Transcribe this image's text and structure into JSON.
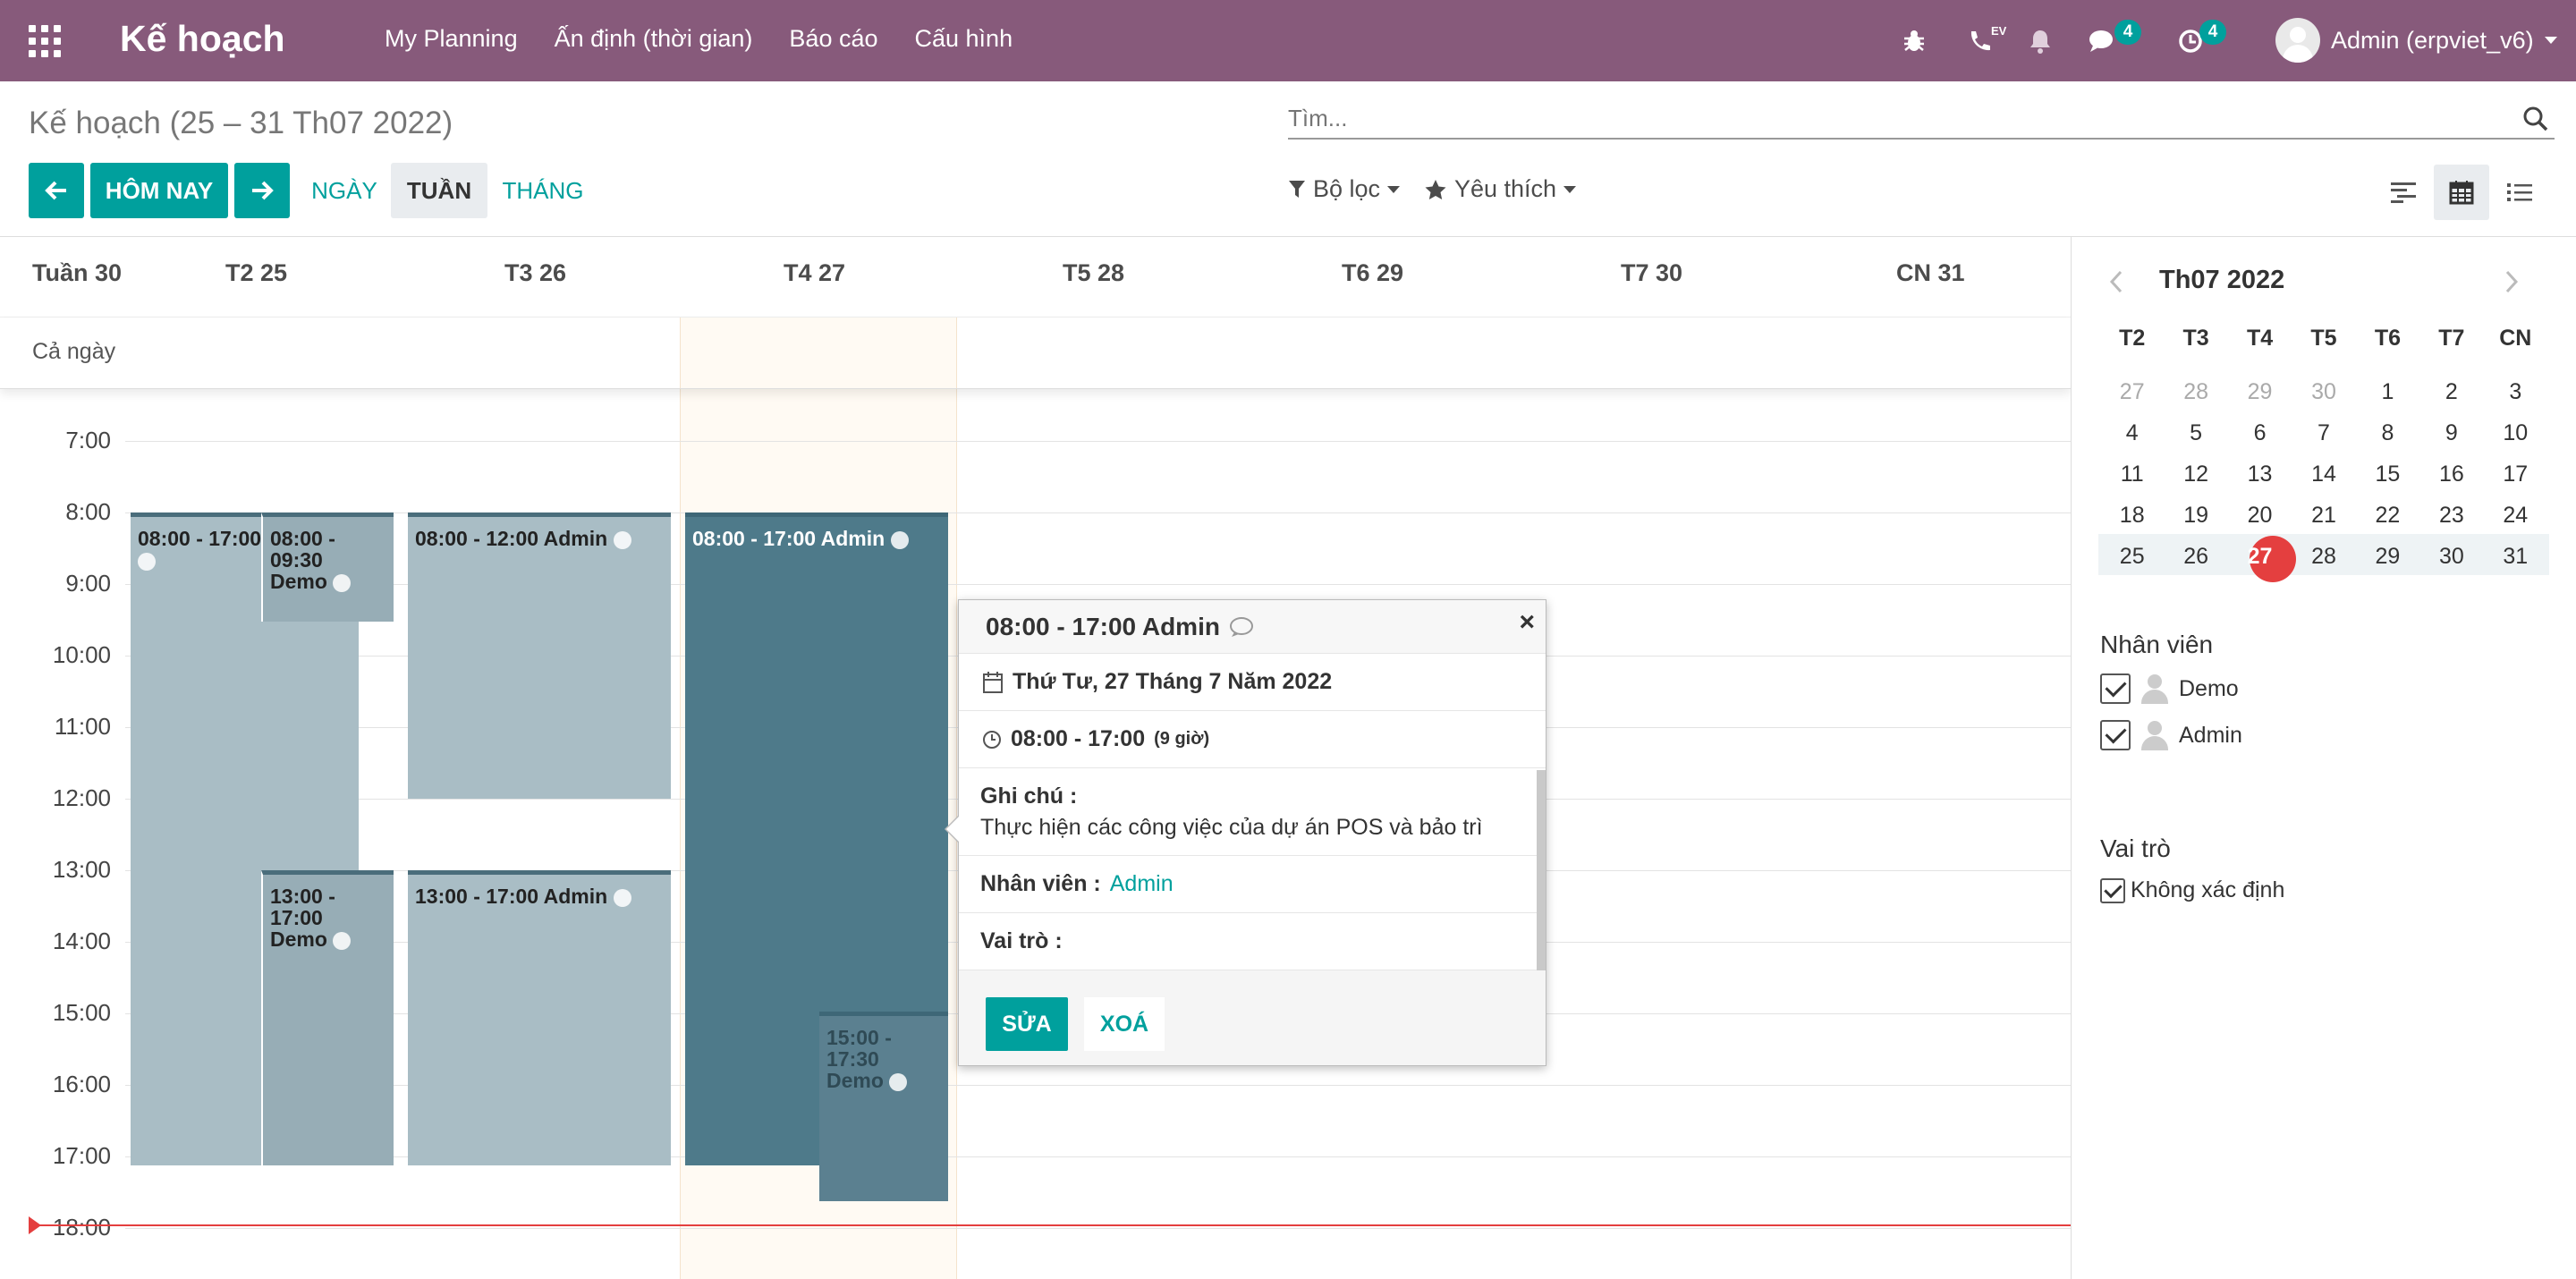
{
  "navbar": {
    "brand": "Kế hoạch",
    "menu": [
      "My Planning",
      "Ấn định (thời gian)",
      "Báo cáo",
      "Cấu hình"
    ],
    "voip_tag": "EV",
    "messages_count": "4",
    "activities_count": "4",
    "user": "Admin (erpviet_v6)"
  },
  "control": {
    "title": "Kế hoạch (25 – 31 Th07 2022)",
    "search_placeholder": "Tìm...",
    "today": "HÔM NAY",
    "scale_day": "NGÀY",
    "scale_week": "TUẦN",
    "scale_month": "THÁNG",
    "filter": "Bộ lọc",
    "favorite": "Yêu thích"
  },
  "calendar": {
    "week_label": "Tuần 30",
    "days": [
      "T2 25",
      "T3 26",
      "T4 27",
      "T5 28",
      "T6 29",
      "T7 30",
      "CN 31"
    ],
    "allday": "Cả ngày",
    "hours": [
      "7:00",
      "8:00",
      "9:00",
      "10:00",
      "11:00",
      "12:00",
      "13:00",
      "14:00",
      "15:00",
      "16:00",
      "17:00",
      "18:00"
    ],
    "events": {
      "mon_admin": "08:00 - 17:00",
      "mon_demo_am_time": "08:00 - 09:30",
      "mon_demo_am_name": "Demo",
      "mon_demo_pm_time": "13:00 - 17:00",
      "mon_demo_pm_name": "Demo",
      "tue_am": "08:00 - 12:00 Admin",
      "tue_pm": "13:00 - 17:00 Admin",
      "wed_admin": "08:00 - 17:00 Admin",
      "wed_demo_time": "15:00 - 17:30",
      "wed_demo_name": "Demo"
    }
  },
  "popover": {
    "title": "08:00 - 17:00 Admin",
    "date": "Thứ Tư, 27 Tháng 7 Năm 2022",
    "time": "08:00 - 17:00",
    "duration": "(9 giờ)",
    "note_label": "Ghi chú :",
    "note_value": "Thực hiện các công việc của dự án POS và bảo trì",
    "employee_label": "Nhân viên :",
    "employee_value": "Admin",
    "role_label": "Vai trò :",
    "edit": "SỬA",
    "delete": "XOÁ",
    "close": "×"
  },
  "sidebar": {
    "month": "Th07 2022",
    "weekdays": [
      "T2",
      "T3",
      "T4",
      "T5",
      "T6",
      "T7",
      "CN"
    ],
    "weeks": [
      [
        "27",
        "28",
        "29",
        "30",
        "1",
        "2",
        "3"
      ],
      [
        "4",
        "5",
        "6",
        "7",
        "8",
        "9",
        "10"
      ],
      [
        "11",
        "12",
        "13",
        "14",
        "15",
        "16",
        "17"
      ],
      [
        "18",
        "19",
        "20",
        "21",
        "22",
        "23",
        "24"
      ],
      [
        "25",
        "26",
        "27",
        "28",
        "29",
        "30",
        "31"
      ]
    ],
    "employees_title": "Nhân viên",
    "employees": [
      "Demo",
      "Admin"
    ],
    "roles_title": "Vai trò",
    "roles": [
      "Không xác định"
    ]
  },
  "colors": {
    "brand": "#875a7b",
    "accent": "#00a09d",
    "event": "#a9bdc5",
    "event_selected": "#4e7a8a",
    "now_line": "#e43f3f"
  }
}
